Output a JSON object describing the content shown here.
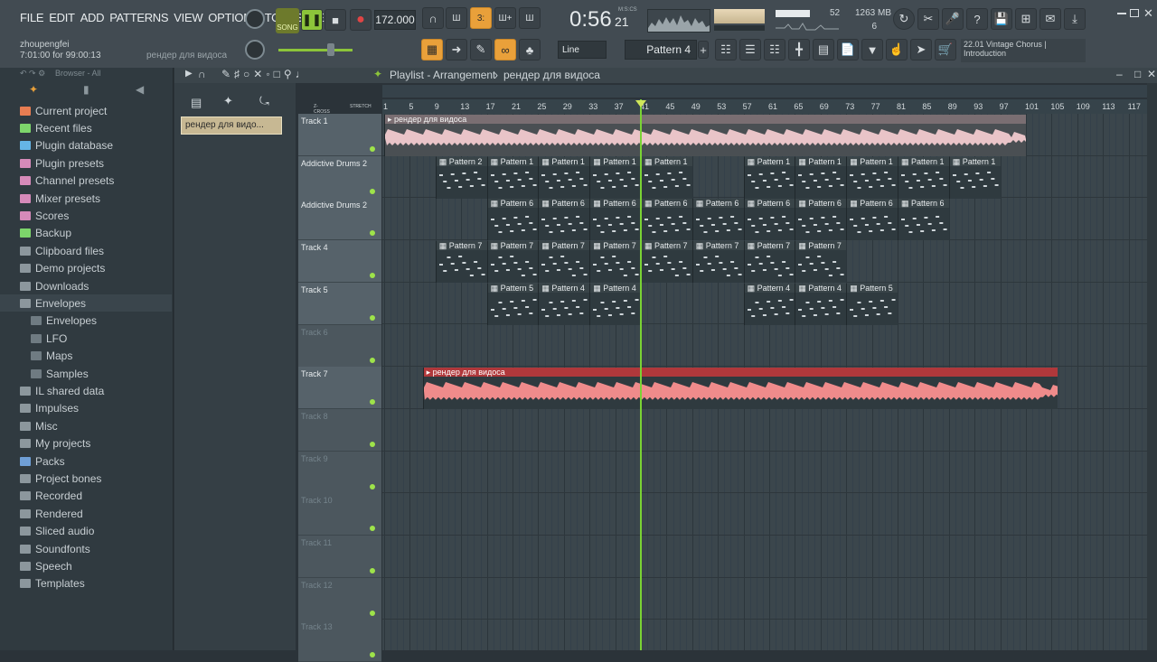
{
  "menu": [
    "FILE",
    "EDIT",
    "ADD",
    "PATTERNS",
    "VIEW",
    "OPTIONS",
    "TOOLS",
    "HELP"
  ],
  "hint": {
    "user": "zhoupengfei",
    "time": "7:01:00 for 99:00:13",
    "project": "рендер для видоса"
  },
  "transport": {
    "song_label": "SONG",
    "tempo": "172.000",
    "time": "0:56",
    "time_frac": "21",
    "time_unit": "M:S:CS",
    "cpu": "52",
    "ram": "1263 MB",
    "poly": "6"
  },
  "toolbar2": {
    "snap": "Line",
    "pattern": "Pattern 4",
    "hint_num": "22.01",
    "hint_title": "Vintage Chorus |",
    "hint_sub": "Introduction"
  },
  "browser": {
    "title": "Browser - All",
    "items": [
      {
        "label": "Current project",
        "color": "#e87d52",
        "sub": false
      },
      {
        "label": "Recent files",
        "color": "#7dd66b",
        "sub": false
      },
      {
        "label": "Plugin database",
        "color": "#65b5e6",
        "sub": false
      },
      {
        "label": "Plugin presets",
        "color": "#d68ab9",
        "sub": false
      },
      {
        "label": "Channel presets",
        "color": "#d68ab9",
        "sub": false
      },
      {
        "label": "Mixer presets",
        "color": "#d68ab9",
        "sub": false
      },
      {
        "label": "Scores",
        "color": "#d68ab9",
        "sub": false
      },
      {
        "label": "Backup",
        "color": "#7dd66b",
        "sub": false
      },
      {
        "label": "Clipboard files",
        "color": "#8c979d",
        "sub": false
      },
      {
        "label": "Demo projects",
        "color": "#8c979d",
        "sub": false
      },
      {
        "label": "Downloads",
        "color": "#8c979d",
        "sub": false
      },
      {
        "label": "Envelopes",
        "color": "#8c979d",
        "sub": false,
        "active": true
      },
      {
        "label": "Envelopes",
        "color": "#6f7b82",
        "sub": true
      },
      {
        "label": "LFO",
        "color": "#6f7b82",
        "sub": true
      },
      {
        "label": "Maps",
        "color": "#6f7b82",
        "sub": true
      },
      {
        "label": "Samples",
        "color": "#6f7b82",
        "sub": true
      },
      {
        "label": "IL shared data",
        "color": "#8c979d",
        "sub": false
      },
      {
        "label": "Impulses",
        "color": "#8c979d",
        "sub": false
      },
      {
        "label": "Misc",
        "color": "#8c979d",
        "sub": false
      },
      {
        "label": "My projects",
        "color": "#8c979d",
        "sub": false
      },
      {
        "label": "Packs",
        "color": "#6f9fd6",
        "sub": false
      },
      {
        "label": "Project bones",
        "color": "#8c979d",
        "sub": false
      },
      {
        "label": "Recorded",
        "color": "#8c979d",
        "sub": false
      },
      {
        "label": "Rendered",
        "color": "#8c979d",
        "sub": false
      },
      {
        "label": "Sliced audio",
        "color": "#8c979d",
        "sub": false
      },
      {
        "label": "Soundfonts",
        "color": "#8c979d",
        "sub": false
      },
      {
        "label": "Speech",
        "color": "#8c979d",
        "sub": false
      },
      {
        "label": "Templates",
        "color": "#8c979d",
        "sub": false
      }
    ]
  },
  "playlist": {
    "title": "Playlist - Arrangement",
    "project": "рендер для видоса",
    "selected_clip": "рендер для видо...",
    "zcross": "Z-CROSS",
    "stretch": "STRETCH",
    "ruler": [
      "1",
      "5",
      "9",
      "13",
      "17",
      "21",
      "25",
      "29",
      "33",
      "37",
      "41",
      "45",
      "49",
      "53",
      "57",
      "61",
      "65",
      "69",
      "73",
      "77",
      "81",
      "85",
      "89",
      "93",
      "97",
      "101",
      "105",
      "109",
      "113",
      "117"
    ],
    "tracks": [
      {
        "name": "Track 1",
        "dim": false
      },
      {
        "name": "Addictive Drums 2",
        "dim": false
      },
      {
        "name": "Addictive Drums 2",
        "dim": false
      },
      {
        "name": "Track 4",
        "dim": false
      },
      {
        "name": "Track 5",
        "dim": false
      },
      {
        "name": "Track 6",
        "dim": true
      },
      {
        "name": "Track 7",
        "dim": false
      },
      {
        "name": "Track 8",
        "dim": true
      },
      {
        "name": "Track 9",
        "dim": true
      },
      {
        "name": "Track 10",
        "dim": true
      },
      {
        "name": "Track 11",
        "dim": true
      },
      {
        "name": "Track 12",
        "dim": true
      },
      {
        "name": "Track 13",
        "dim": true
      }
    ],
    "clips": [
      {
        "row": 0,
        "start": 1,
        "len": 100,
        "label": "рендер для видоса",
        "kind": "audio1"
      },
      {
        "row": 1,
        "start": 9,
        "len": 8,
        "label": "Pattern 2",
        "kind": "pat"
      },
      {
        "row": 1,
        "start": 17,
        "len": 8,
        "label": "Pattern 1",
        "kind": "pat"
      },
      {
        "row": 1,
        "start": 25,
        "len": 8,
        "label": "Pattern 1",
        "kind": "pat"
      },
      {
        "row": 1,
        "start": 33,
        "len": 8,
        "label": "Pattern 1",
        "kind": "pat"
      },
      {
        "row": 1,
        "start": 41,
        "len": 8,
        "label": "Pattern 1",
        "kind": "pat"
      },
      {
        "row": 1,
        "start": 57,
        "len": 8,
        "label": "Pattern 1",
        "kind": "pat"
      },
      {
        "row": 1,
        "start": 65,
        "len": 8,
        "label": "Pattern 1",
        "kind": "pat"
      },
      {
        "row": 1,
        "start": 73,
        "len": 8,
        "label": "Pattern 1",
        "kind": "pat"
      },
      {
        "row": 1,
        "start": 81,
        "len": 8,
        "label": "Pattern 1",
        "kind": "pat"
      },
      {
        "row": 1,
        "start": 89,
        "len": 8,
        "label": "Pattern 1",
        "kind": "pat"
      },
      {
        "row": 2,
        "start": 17,
        "len": 8,
        "label": "Pattern 6",
        "kind": "pat"
      },
      {
        "row": 2,
        "start": 25,
        "len": 8,
        "label": "Pattern 6",
        "kind": "pat"
      },
      {
        "row": 2,
        "start": 33,
        "len": 8,
        "label": "Pattern 6",
        "kind": "pat"
      },
      {
        "row": 2,
        "start": 41,
        "len": 8,
        "label": "Pattern 6",
        "kind": "pat"
      },
      {
        "row": 2,
        "start": 49,
        "len": 8,
        "label": "Pattern 6",
        "kind": "pat"
      },
      {
        "row": 2,
        "start": 57,
        "len": 8,
        "label": "Pattern 6",
        "kind": "pat"
      },
      {
        "row": 2,
        "start": 65,
        "len": 8,
        "label": "Pattern 6",
        "kind": "pat"
      },
      {
        "row": 2,
        "start": 73,
        "len": 8,
        "label": "Pattern 6",
        "kind": "pat"
      },
      {
        "row": 2,
        "start": 81,
        "len": 8,
        "label": "Pattern 6",
        "kind": "pat"
      },
      {
        "row": 3,
        "start": 9,
        "len": 8,
        "label": "Pattern 7",
        "kind": "pat"
      },
      {
        "row": 3,
        "start": 17,
        "len": 8,
        "label": "Pattern 7",
        "kind": "pat"
      },
      {
        "row": 3,
        "start": 25,
        "len": 8,
        "label": "Pattern 7",
        "kind": "pat"
      },
      {
        "row": 3,
        "start": 33,
        "len": 8,
        "label": "Pattern 7",
        "kind": "pat"
      },
      {
        "row": 3,
        "start": 41,
        "len": 8,
        "label": "Pattern 7",
        "kind": "pat"
      },
      {
        "row": 3,
        "start": 49,
        "len": 8,
        "label": "Pattern 7",
        "kind": "pat"
      },
      {
        "row": 3,
        "start": 57,
        "len": 8,
        "label": "Pattern 7",
        "kind": "pat"
      },
      {
        "row": 3,
        "start": 65,
        "len": 8,
        "label": "Pattern 7",
        "kind": "pat"
      },
      {
        "row": 4,
        "start": 17,
        "len": 8,
        "label": "Pattern 5",
        "kind": "pat"
      },
      {
        "row": 4,
        "start": 25,
        "len": 8,
        "label": "Pattern 4",
        "kind": "pat"
      },
      {
        "row": 4,
        "start": 33,
        "len": 8,
        "label": "Pattern 4",
        "kind": "pat"
      },
      {
        "row": 4,
        "start": 57,
        "len": 8,
        "label": "Pattern 4",
        "kind": "pat"
      },
      {
        "row": 4,
        "start": 65,
        "len": 8,
        "label": "Pattern 4",
        "kind": "pat"
      },
      {
        "row": 4,
        "start": 73,
        "len": 8,
        "label": "Pattern 5",
        "kind": "pat"
      },
      {
        "row": 6,
        "start": 7,
        "len": 99,
        "label": "рендер для видоса",
        "kind": "audio2"
      }
    ],
    "playhead_bar": 41
  },
  "colors": {
    "accent": "#e9a03a",
    "playhead": "#7ad334",
    "audio1_wave": "#e9c4c8",
    "audio2_wave": "#ef8b8b",
    "audio2_hdr": "#b0383b"
  }
}
